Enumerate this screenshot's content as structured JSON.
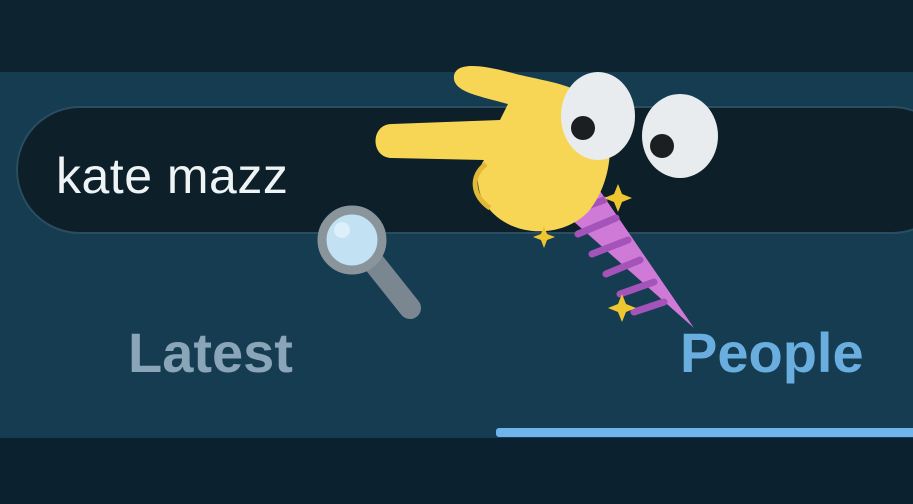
{
  "search": {
    "query": "kate mazz"
  },
  "tabs": [
    {
      "label": "Latest",
      "selected": false
    },
    {
      "label": "People",
      "selected": true
    }
  ],
  "colors": {
    "background": "#143446",
    "search_field": "#0d1f28",
    "tab_inactive": "#8aa4b8",
    "tab_active": "#6aaee0",
    "indicator": "#6fb4ea"
  },
  "stickers": {
    "magnifier": "magnifying-glass-icon",
    "pointer": "pointing-hand-unicorn-sticker"
  }
}
